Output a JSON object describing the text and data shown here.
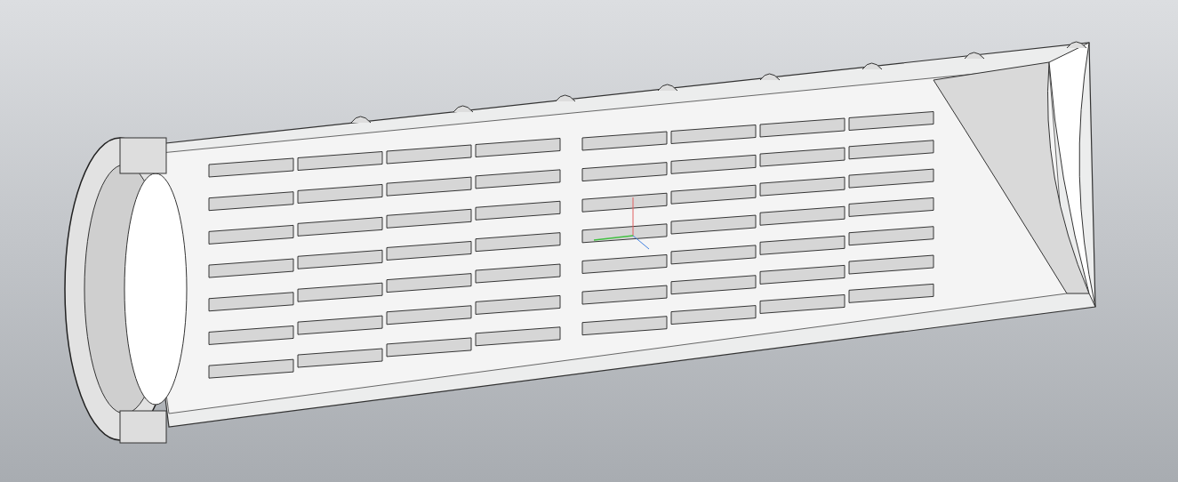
{
  "viewport": {
    "show_model": true,
    "show_axes": true
  }
}
